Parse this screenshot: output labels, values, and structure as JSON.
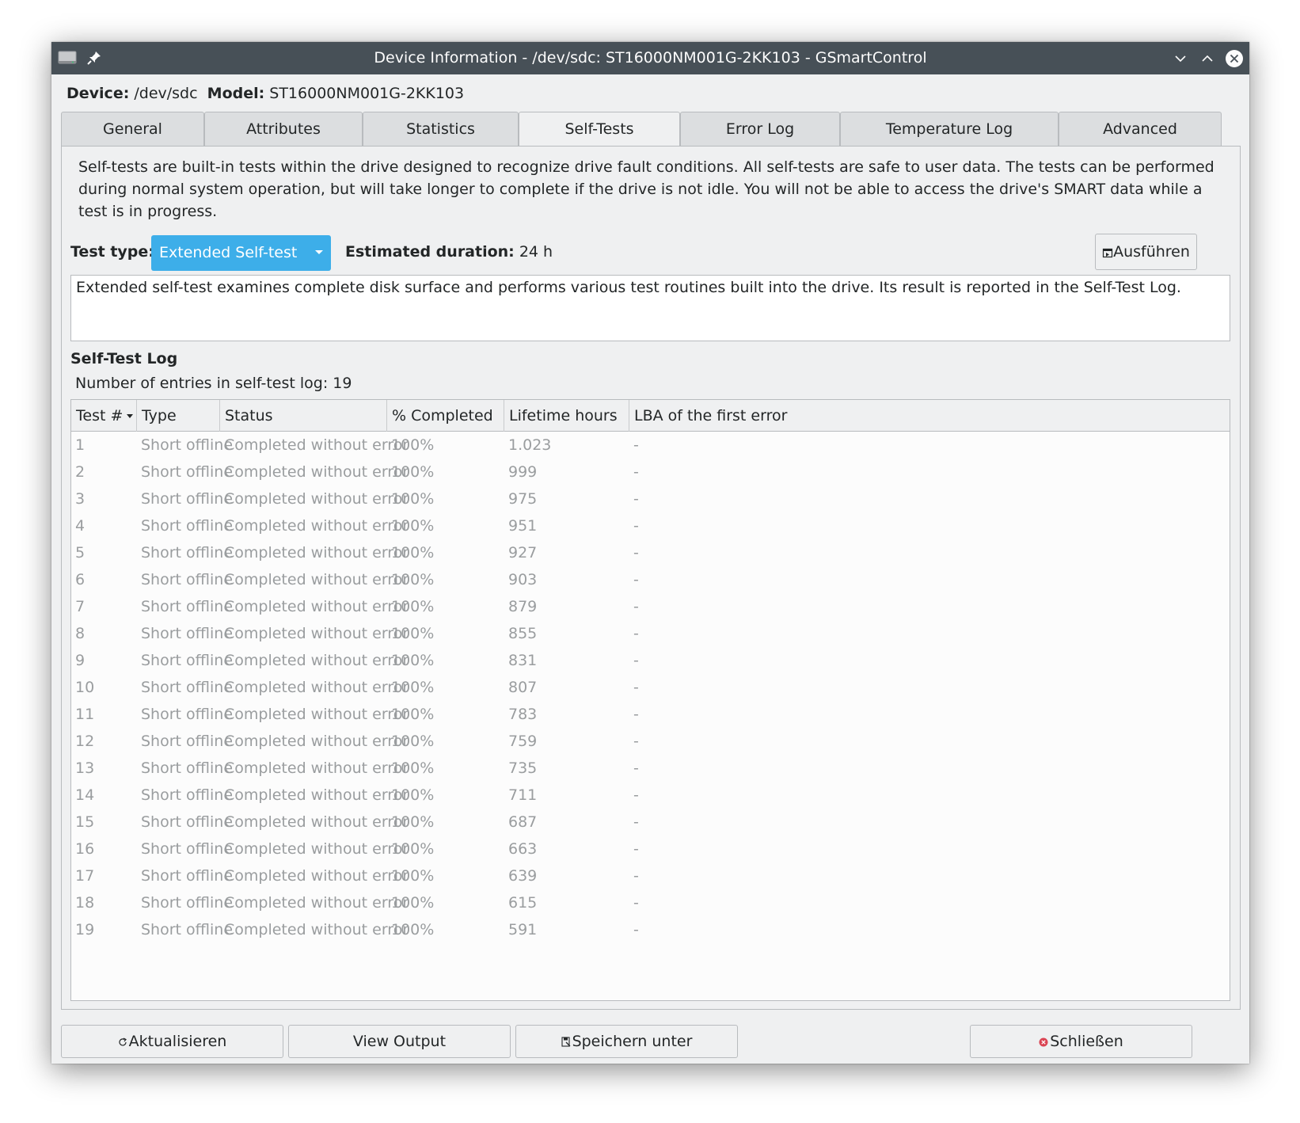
{
  "window": {
    "title": "Device Information - /dev/sdc: ST16000NM001G-2KK103 - GSmartControl"
  },
  "device": {
    "device_label": "Device:",
    "device_value": "/dev/sdc",
    "model_label": "Model:",
    "model_value": "ST16000NM001G-2KK103"
  },
  "tabs": [
    {
      "label": "General"
    },
    {
      "label": "Attributes"
    },
    {
      "label": "Statistics"
    },
    {
      "label": "Self-Tests",
      "active": true
    },
    {
      "label": "Error Log"
    },
    {
      "label": "Temperature Log"
    },
    {
      "label": "Advanced"
    }
  ],
  "selftests": {
    "description": "Self-tests are built-in tests within the drive designed to recognize drive fault conditions. All self-tests are safe to user data. The tests can be performed during normal system operation, but will take longer to complete if the drive is not idle. You will not be able to access the drive's SMART data while a test is in progress.",
    "test_type_label": "Test type:",
    "test_type_value": "Extended Self-test",
    "duration_label": "Estimated duration:",
    "duration_value": "24 h",
    "run_label": "Ausführen",
    "test_description": "Extended self-test examines complete disk surface and performs various test routines built into the drive. Its result is reported in the Self-Test Log."
  },
  "log": {
    "title": "Self-Test Log",
    "count_text": "Number of entries in self-test log: 19",
    "columns": [
      "Test #",
      "Type",
      "Status",
      "% Completed",
      "Lifetime hours",
      "LBA of the first error"
    ],
    "rows": [
      [
        "1",
        "Short offline",
        "Completed without error",
        "100%",
        "1.023",
        "-"
      ],
      [
        "2",
        "Short offline",
        "Completed without error",
        "100%",
        "999",
        "-"
      ],
      [
        "3",
        "Short offline",
        "Completed without error",
        "100%",
        "975",
        "-"
      ],
      [
        "4",
        "Short offline",
        "Completed without error",
        "100%",
        "951",
        "-"
      ],
      [
        "5",
        "Short offline",
        "Completed without error",
        "100%",
        "927",
        "-"
      ],
      [
        "6",
        "Short offline",
        "Completed without error",
        "100%",
        "903",
        "-"
      ],
      [
        "7",
        "Short offline",
        "Completed without error",
        "100%",
        "879",
        "-"
      ],
      [
        "8",
        "Short offline",
        "Completed without error",
        "100%",
        "855",
        "-"
      ],
      [
        "9",
        "Short offline",
        "Completed without error",
        "100%",
        "831",
        "-"
      ],
      [
        "10",
        "Short offline",
        "Completed without error",
        "100%",
        "807",
        "-"
      ],
      [
        "11",
        "Short offline",
        "Completed without error",
        "100%",
        "783",
        "-"
      ],
      [
        "12",
        "Short offline",
        "Completed without error",
        "100%",
        "759",
        "-"
      ],
      [
        "13",
        "Short offline",
        "Completed without error",
        "100%",
        "735",
        "-"
      ],
      [
        "14",
        "Short offline",
        "Completed without error",
        "100%",
        "711",
        "-"
      ],
      [
        "15",
        "Short offline",
        "Completed without error",
        "100%",
        "687",
        "-"
      ],
      [
        "16",
        "Short offline",
        "Completed without error",
        "100%",
        "663",
        "-"
      ],
      [
        "17",
        "Short offline",
        "Completed without error",
        "100%",
        "639",
        "-"
      ],
      [
        "18",
        "Short offline",
        "Completed without error",
        "100%",
        "615",
        "-"
      ],
      [
        "19",
        "Short offline",
        "Completed without error",
        "100%",
        "591",
        "-"
      ]
    ]
  },
  "buttons": {
    "refresh": "Aktualisieren",
    "view_output": "View Output",
    "save_as": "Speichern unter",
    "close": "Schließen"
  },
  "colors": {
    "accent": "#3daee9",
    "titlebar": "#475057",
    "close_red": "#da4453"
  },
  "icons": {
    "app": "harddisk-icon",
    "pin": "pin-icon",
    "minimize": "chevron-down-icon",
    "maximize": "chevron-up-icon",
    "close": "close-circle-icon",
    "run": "execute-icon",
    "refresh": "refresh-icon",
    "save": "save-as-icon",
    "close_dialog": "close-red-icon"
  }
}
